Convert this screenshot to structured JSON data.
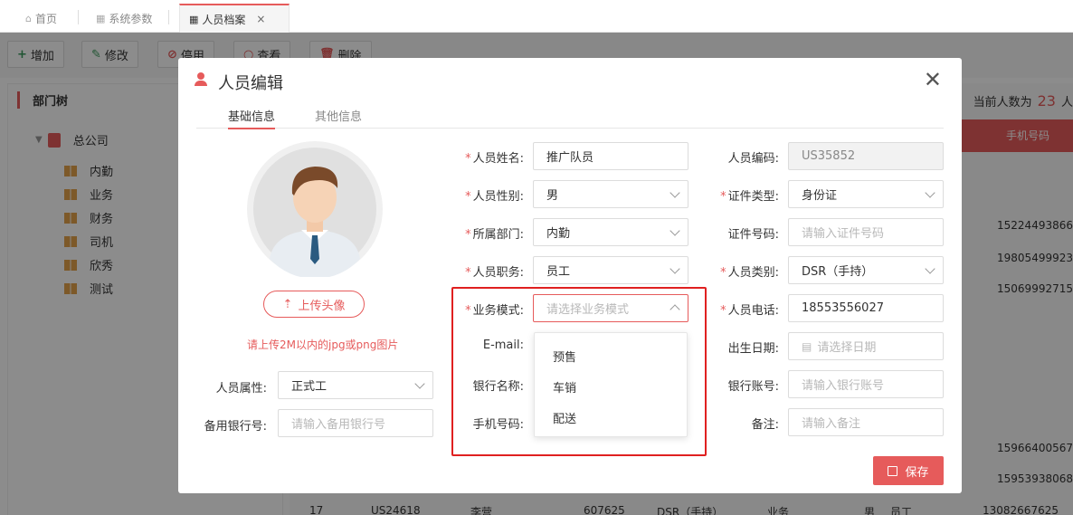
{
  "tabs": [
    {
      "icon": "home-icon",
      "label": "首页"
    },
    {
      "icon": "grid-icon",
      "label": "系统参数"
    },
    {
      "icon": "grid-icon",
      "label": "人员档案",
      "close": "×"
    }
  ],
  "toolbar": {
    "buttons": [
      "增加",
      "修改",
      "停用",
      "查看",
      "删除"
    ]
  },
  "tree": {
    "title": "部门树",
    "root": "总公司",
    "children": [
      "内勤",
      "业务",
      "财务",
      "司机",
      "欣秀",
      "测试"
    ]
  },
  "grid": {
    "count_label": "当前人数为",
    "count_value": "23",
    "count_suffix": "人",
    "last_col_header": "手机号码",
    "phones": [
      "15224493866",
      "19805499923",
      "15069992715",
      "15966400567",
      "15953938068",
      "13082667625"
    ],
    "last_row": {
      "index": "17",
      "code": "US24618",
      "name": "李营",
      "id": "607625",
      "category": "DSR（手持）",
      "mode": "业务",
      "gender": "男",
      "role": "员工"
    }
  },
  "modal": {
    "title": "人员编辑",
    "close": "✕",
    "tabs": [
      "基础信息",
      "其他信息"
    ],
    "upload_label": "上传头像",
    "upload_hint": "请上传2M以内的jpg或png图片",
    "save_label": "保存",
    "left_fields": {
      "attr_label": "人员属性:",
      "attr_value": "正式工",
      "bank_backup_label": "备用银行号:",
      "bank_backup_placeholder": "请输入备用银行号"
    },
    "fields": {
      "name_label": "人员姓名:",
      "name_value": "推广队员",
      "code_label": "人员编码:",
      "code_value": "US35852",
      "gender_label": "人员性别:",
      "gender_value": "男",
      "cert_type_label": "证件类型:",
      "cert_type_value": "身份证",
      "dept_label": "所属部门:",
      "dept_value": "内勤",
      "cert_no_label": "证件号码:",
      "cert_no_placeholder": "请输入证件号码",
      "job_label": "人员职务:",
      "job_value": "员工",
      "category_label": "人员类别:",
      "category_value": "DSR（手持）",
      "mode_label": "业务模式:",
      "mode_placeholder": "请选择业务模式",
      "phone_label": "人员电话:",
      "phone_value": "18553556027",
      "email_label": "E-mail:",
      "birth_label": "出生日期:",
      "birth_placeholder": "请选择日期",
      "bank_name_label": "银行名称:",
      "bank_acct_label": "银行账号:",
      "bank_acct_placeholder": "请输入银行账号",
      "mobile_label": "手机号码:",
      "remark_label": "备注:",
      "remark_placeholder": "请输入备注"
    },
    "mode_options": [
      "预售",
      "车销",
      "配送"
    ]
  },
  "colors": {
    "accent": "#e65b5b",
    "highlight": "#e02020"
  }
}
